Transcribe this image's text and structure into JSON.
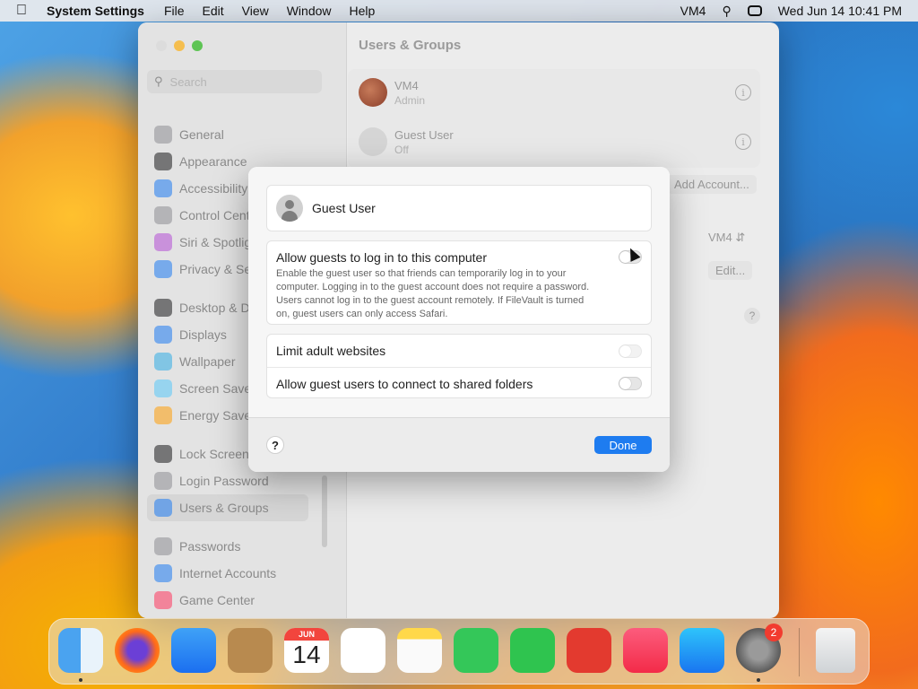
{
  "menubar": {
    "app_name": "System Settings",
    "menus": [
      "File",
      "Edit",
      "View",
      "Window",
      "Help"
    ],
    "user": "VM4",
    "datetime": "Wed Jun 14  10:41 PM"
  },
  "window": {
    "title": "Users & Groups",
    "search_placeholder": "Search",
    "sidebar": {
      "groups": [
        [
          {
            "label": "General",
            "icon": "gear-icon",
            "color": "#8e8e93"
          },
          {
            "label": "Appearance",
            "icon": "appearance-icon",
            "color": "#1c1c1e"
          },
          {
            "label": "Accessibility",
            "icon": "accessibility-icon",
            "color": "#1f7bf2"
          },
          {
            "label": "Control Cente",
            "icon": "control-center-icon",
            "color": "#8e8e93"
          },
          {
            "label": "Siri & Spotlig",
            "icon": "siri-icon",
            "color": "#b44fd6"
          },
          {
            "label": "Privacy & Sec",
            "icon": "hand-icon",
            "color": "#1f7bf2"
          }
        ],
        [
          {
            "label": "Desktop & Do",
            "icon": "dock-icon",
            "color": "#1c1c1e"
          },
          {
            "label": "Displays",
            "icon": "displays-icon",
            "color": "#1f7bf2"
          },
          {
            "label": "Wallpaper",
            "icon": "wallpaper-icon",
            "color": "#32ade6"
          },
          {
            "label": "Screen Saver",
            "icon": "screen-saver-icon",
            "color": "#5ac8fa"
          },
          {
            "label": "Energy Saver",
            "icon": "energy-icon",
            "color": "#ff9f0a"
          }
        ],
        [
          {
            "label": "Lock Screen",
            "icon": "lock-icon",
            "color": "#1c1c1e"
          },
          {
            "label": "Login Password",
            "icon": "password-icon",
            "color": "#8e8e93"
          },
          {
            "label": "Users & Groups",
            "icon": "users-icon",
            "color": "#1f7bf2",
            "active": true
          }
        ],
        [
          {
            "label": "Passwords",
            "icon": "key-icon",
            "color": "#8e8e93"
          },
          {
            "label": "Internet Accounts",
            "icon": "at-icon",
            "color": "#1f7bf2"
          },
          {
            "label": "Game Center",
            "icon": "game-center-icon",
            "color": "#ff375f"
          }
        ]
      ]
    },
    "accounts": [
      {
        "name": "VM4",
        "role": "Admin"
      },
      {
        "name": "Guest User",
        "role": "Off"
      }
    ],
    "add_account_label": "Add Account...",
    "auto_login_value": "VM4",
    "edit_label": "Edit...",
    "help_label": "?"
  },
  "modal": {
    "guest_name": "Guest User",
    "allow_title": "Allow guests to log in to this computer",
    "allow_desc": "Enable the guest user so that friends can temporarily log in to your computer. Logging in to the guest account does not require a password. Users cannot log in to the guest account remotely. If FileVault is turned on, guest users can only access Safari.",
    "allow_enabled": false,
    "limit_label": "Limit adult websites",
    "limit_enabled": false,
    "shared_label": "Allow guest users to connect to shared folders",
    "shared_enabled": false,
    "help_label": "?",
    "done_label": "Done"
  },
  "dock": {
    "calendar_month": "JUN",
    "calendar_day": "14",
    "settings_badge": "2",
    "apps": [
      "Finder",
      "Firefox",
      "Mail",
      "Contacts",
      "Calendar",
      "Reminders",
      "Notes",
      "Messages",
      "FaceTime",
      "Photo Booth",
      "Music",
      "App Store",
      "System Settings",
      "Trash"
    ]
  }
}
